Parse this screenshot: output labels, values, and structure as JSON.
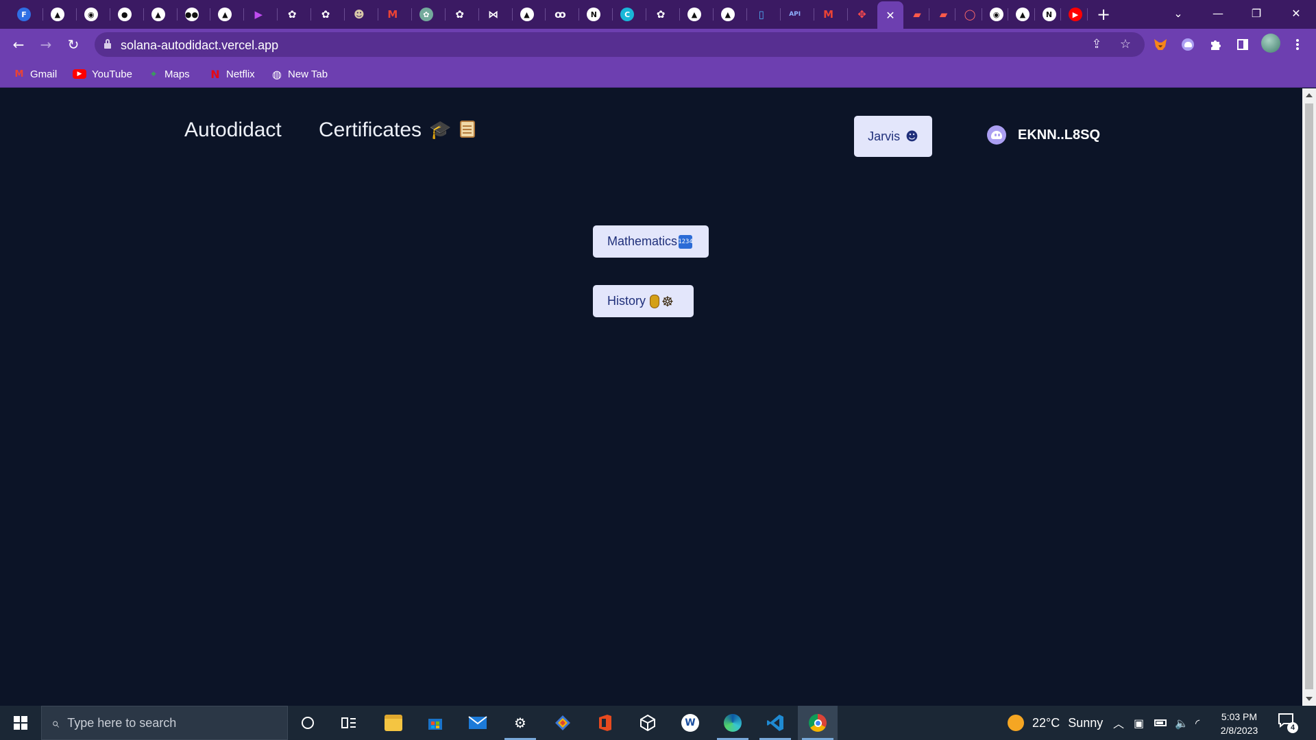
{
  "browser": {
    "tabs": [
      {
        "icon": "favicon-f-icon",
        "glyph": "F",
        "bg": "#2f6fe4",
        "fg": "#ffffff"
      },
      {
        "icon": "favicon-a-triangle-icon",
        "glyph": "▲",
        "bg": "#ffffff",
        "fg": "#111111"
      },
      {
        "icon": "favicon-circle-icon",
        "glyph": "◉",
        "bg": "#ffffff",
        "fg": "#111111"
      },
      {
        "icon": "github-icon",
        "glyph": "●",
        "bg": "#ffffff",
        "fg": "#111111"
      },
      {
        "icon": "favicon-a-triangle-icon",
        "glyph": "▲",
        "bg": "#ffffff",
        "fg": "#111111"
      },
      {
        "icon": "medium-icon",
        "glyph": "●●",
        "bg": "#ffffff",
        "fg": "#111111"
      },
      {
        "icon": "favicon-a-triangle-icon",
        "glyph": "▲",
        "bg": "#ffffff",
        "fg": "#111111"
      },
      {
        "icon": "play-arrow-icon",
        "glyph": "▶",
        "bg": "transparent",
        "fg": "#c04cf0"
      },
      {
        "icon": "openai-icon",
        "glyph": "✿",
        "bg": "transparent",
        "fg": "#ffffff"
      },
      {
        "icon": "openai-icon",
        "glyph": "✿",
        "bg": "transparent",
        "fg": "#ffffff"
      },
      {
        "icon": "robot-avatar-icon",
        "glyph": "☻",
        "bg": "transparent",
        "fg": "#d8c8a8"
      },
      {
        "icon": "gmail-icon",
        "glyph": "M",
        "bg": "transparent",
        "fg": "#ea4335"
      },
      {
        "icon": "chatgpt-icon",
        "glyph": "✿",
        "bg": "#74aa9c",
        "fg": "#ffffff"
      },
      {
        "icon": "openai-icon",
        "glyph": "✿",
        "bg": "transparent",
        "fg": "#ffffff"
      },
      {
        "icon": "bow-tie-icon",
        "glyph": "⋈",
        "bg": "transparent",
        "fg": "#ffffff"
      },
      {
        "icon": "favicon-a-triangle-icon",
        "glyph": "▲",
        "bg": "#ffffff",
        "fg": "#111111"
      },
      {
        "icon": "eyes-icon",
        "glyph": "ꝏ",
        "bg": "transparent",
        "fg": "#ffffff"
      },
      {
        "icon": "notion-icon",
        "glyph": "N",
        "bg": "#ffffff",
        "fg": "#111111"
      },
      {
        "icon": "canva-icon",
        "glyph": "C",
        "bg": "#19b7d8",
        "fg": "#ffffff"
      },
      {
        "icon": "openai-icon",
        "glyph": "✿",
        "bg": "transparent",
        "fg": "#ffffff"
      },
      {
        "icon": "favicon-a-triangle-icon",
        "glyph": "▲",
        "bg": "#ffffff",
        "fg": "#111111"
      },
      {
        "icon": "favicon-a-triangle-icon",
        "glyph": "▲",
        "bg": "#ffffff",
        "fg": "#111111"
      },
      {
        "icon": "bottle-icon",
        "glyph": "▯",
        "bg": "transparent",
        "fg": "#4ea8f0"
      },
      {
        "icon": "api-icon",
        "glyph": "API",
        "bg": "transparent",
        "fg": "#8fb0ff"
      },
      {
        "icon": "gmail-icon",
        "glyph": "M",
        "bg": "transparent",
        "fg": "#ea4335"
      },
      {
        "icon": "red-diamond-icon",
        "glyph": "✥",
        "bg": "transparent",
        "fg": "#ff4b4b"
      }
    ],
    "tabs_after": [
      {
        "icon": "red-cube-icon",
        "glyph": "▰",
        "bg": "transparent",
        "fg": "#ff5a4a"
      },
      {
        "icon": "red-cube-icon",
        "glyph": "▰",
        "bg": "transparent",
        "fg": "#ff5a4a"
      },
      {
        "icon": "ring-icon",
        "glyph": "◯",
        "bg": "transparent",
        "fg": "#ff6a6a"
      },
      {
        "icon": "favicon-circle-icon",
        "glyph": "◉",
        "bg": "#ffffff",
        "fg": "#111111"
      },
      {
        "icon": "favicon-a-triangle-icon",
        "glyph": "▲",
        "bg": "#ffffff",
        "fg": "#111111"
      },
      {
        "icon": "notion-icon",
        "glyph": "N",
        "bg": "#ffffff",
        "fg": "#111111"
      },
      {
        "icon": "youtube-icon",
        "glyph": "▶",
        "bg": "#ff0000",
        "fg": "#ffffff"
      }
    ],
    "active_tab_close": "✕",
    "new_tab": "+",
    "tab_search": "⌄",
    "minimize": "—",
    "restore": "❐",
    "close": "✕",
    "url": "solana-autodidact.vercel.app",
    "back": "←",
    "forward": "→",
    "reload": "↻",
    "share": "⇪",
    "star": "☆",
    "bookmarks": [
      {
        "label": "Gmail",
        "icon": "gmail-icon",
        "glyph": "M",
        "color": "#ea4335"
      },
      {
        "label": "YouTube",
        "icon": "youtube-icon",
        "glyph": "▶",
        "color": "#ff0000"
      },
      {
        "label": "Maps",
        "icon": "maps-icon",
        "glyph": "⌖",
        "color": "#34a853"
      },
      {
        "label": "Netflix",
        "icon": "netflix-icon",
        "glyph": "N",
        "color": "#e50914"
      },
      {
        "label": "New Tab",
        "icon": "globe-icon",
        "glyph": "◍",
        "color": "#ffffff"
      }
    ]
  },
  "app": {
    "brand": "Autodidact",
    "certificates": "Certificates",
    "cap_emoji": "🎓",
    "jarvis_label": "Jarvis",
    "jarvis_emoji": "☻",
    "wallet_address": "EKNN..L8SQ",
    "subjects": {
      "mathematics": "Mathematics",
      "mathematics_emoji": "1234",
      "history": "History",
      "history_emoji": "☸"
    }
  },
  "taskbar": {
    "search_placeholder": "Type here to search",
    "search_glyph": "⌕",
    "weather_temp": "22°C",
    "weather_desc": "Sunny",
    "time": "5:03 PM",
    "date": "2/8/2023",
    "notifications": "4"
  }
}
